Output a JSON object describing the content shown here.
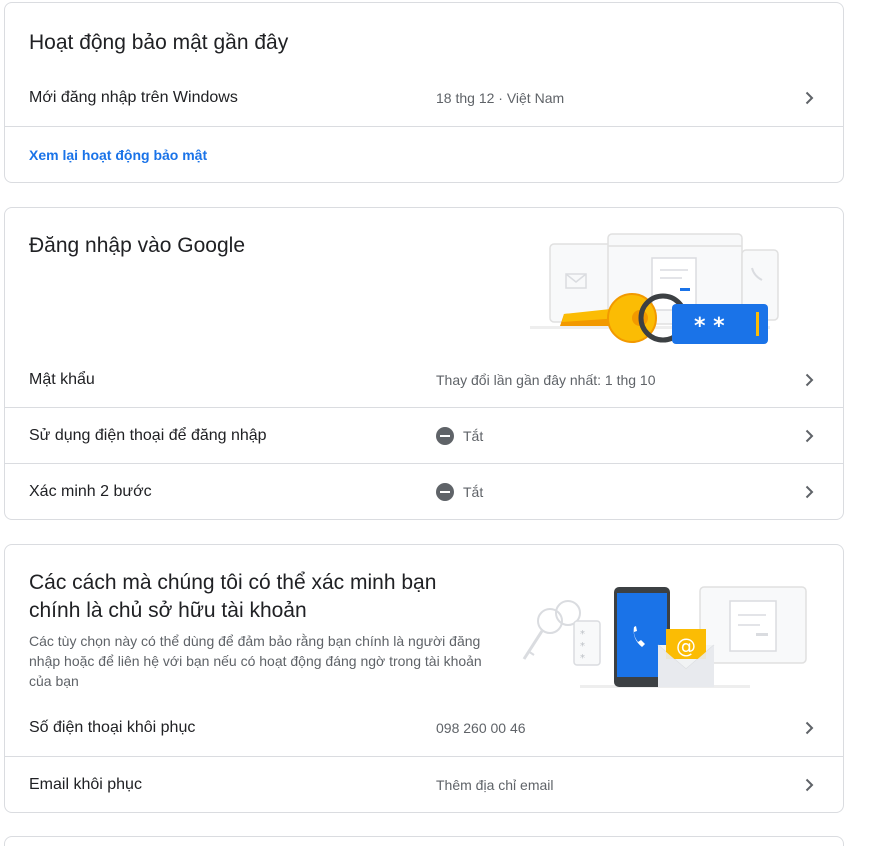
{
  "recent_activity": {
    "title": "Hoạt động bảo mật gần đây",
    "rows": [
      {
        "label": "Mới đăng nhập trên Windows",
        "value": "18 thg 12 · Việt Nam"
      }
    ],
    "link": "Xem lại hoạt động bảo mật"
  },
  "signin": {
    "title": "Đăng nhập vào Google",
    "rows": [
      {
        "label": "Mật khẩu",
        "value": "Thay đổi lần gần đây nhất: 1 thg 10"
      },
      {
        "label": "Sử dụng điện thoại để đăng nhập",
        "value": "Tắt"
      },
      {
        "label": "Xác minh 2 bước",
        "value": "Tắt"
      }
    ],
    "illustration_text": "* *"
  },
  "verify": {
    "title_line1": "Các cách mà chúng tôi có thể xác minh bạn",
    "title_line2": "chính là chủ sở hữu tài khoản",
    "description": "Các tùy chọn này có thể dùng để đảm bảo rằng bạn chính là người đăng nhập hoặc để liên hệ với bạn nếu có hoạt động đáng ngờ trong tài khoản của bạn",
    "rows": [
      {
        "label": "Số điện thoại khôi phục",
        "value": "098 260 00 46"
      },
      {
        "label": "Email khôi phục",
        "value": "Thêm địa chỉ email"
      }
    ]
  },
  "colors": {
    "accent": "#1a73e8",
    "key_yellow": "#fbbc04",
    "key_orange": "#f29900",
    "divider": "#dadce0"
  },
  "icons": [
    "chevron-right-icon",
    "off-status-icon",
    "key-illustration",
    "phone-illustration",
    "email-illustration"
  ]
}
